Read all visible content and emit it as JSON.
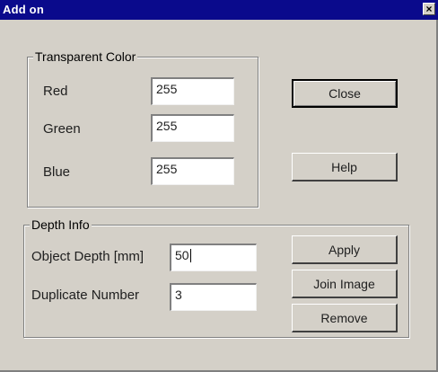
{
  "window": {
    "title": "Add on",
    "close_glyph": "×"
  },
  "transparent_color": {
    "legend": "Transparent Color",
    "red_label": "Red",
    "red_value": "255",
    "green_label": "Green",
    "green_value": "255",
    "blue_label": "Blue",
    "blue_value": "255"
  },
  "buttons": {
    "close": "Close",
    "help": "Help",
    "apply": "Apply",
    "join_image": "Join Image",
    "remove": "Remove"
  },
  "depth_info": {
    "legend": "Depth Info",
    "object_depth_label": "Object Depth [mm]",
    "object_depth_value": "50",
    "duplicate_number_label": "Duplicate Number",
    "duplicate_number_value": "3"
  }
}
